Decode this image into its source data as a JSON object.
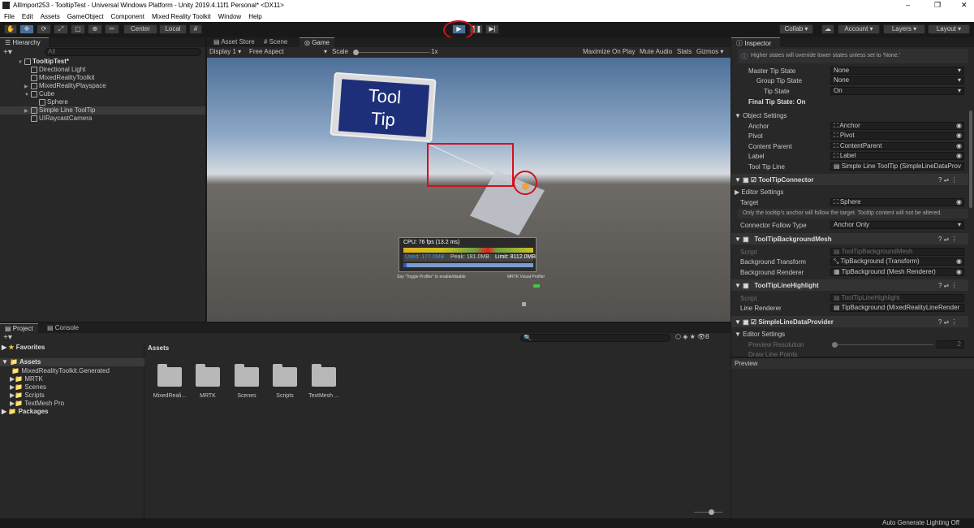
{
  "window": {
    "title": "AllImport253 - TooltipTest - Universal Windows Platform - Unity 2019.4.11f1 Personal* <DX11>",
    "minimize": "–",
    "maximize": "❐",
    "close": "✕"
  },
  "menu": [
    "File",
    "Edit",
    "Assets",
    "GameObject",
    "Component",
    "Mixed Reality Toolkit",
    "Window",
    "Help"
  ],
  "toolbar": {
    "center": "Center",
    "local": "Local",
    "collab": "Collab ▾",
    "account": "Account",
    "layers": "Layers",
    "layout": "Layout"
  },
  "hierarchy": {
    "tab": "Hierarchy",
    "search": "All",
    "scene": "TooltipTest*",
    "items": [
      "Directional Light",
      "MixedRealityToolkit",
      "MixedRealityPlayspace",
      "Cube",
      "Sphere",
      "Simple Line ToolTip",
      "UIRaycastCamera"
    ]
  },
  "center_tabs": [
    "Asset Store",
    "Scene",
    "Game"
  ],
  "game_bar": {
    "display": "Display 1",
    "aspect": "Free Aspect",
    "scale": "Scale",
    "scale_val": "1x",
    "maximize": "Maximize On Play",
    "mute": "Mute Audio",
    "stats": "Stats",
    "gizmos": "Gizmos"
  },
  "scene_view": {
    "tooltip_line1": "Tool",
    "tooltip_line2": "Tip",
    "cpu": "CPU: 76 fps (13.2 ms)",
    "used": "Used: 177.0MB",
    "peak": "Peak: 181.0MB",
    "limit": "Limit: 8112.0MB",
    "say": "Say \"Toggle Profiler\" to enable/disable",
    "mrtk": "MRTK Visual Profiler"
  },
  "inspector": {
    "tab": "Inspector",
    "note": "Higher states will override lower states unless set to 'None.'",
    "master_tip_state": {
      "label": "Master Tip State",
      "value": "None"
    },
    "group_tip_state": {
      "label": "Group Tip State",
      "value": "None"
    },
    "tip_state": {
      "label": "Tip State",
      "value": "On"
    },
    "final_tip_state": "Final Tip State: On",
    "object_settings": "Object Settings",
    "anchor": {
      "label": "Anchor",
      "value": "Anchor"
    },
    "pivot": {
      "label": "Pivot",
      "value": "Pivot"
    },
    "content_parent": {
      "label": "Content Parent",
      "value": "ContentParent"
    },
    "label": {
      "label": "Label",
      "value": "Label"
    },
    "tool_tip_line": {
      "label": "Tool Tip Line",
      "value": "Simple Line ToolTip (SimpleLineDataProv"
    },
    "connector": {
      "title": "ToolTipConnector",
      "editor_settings": "Editor Settings",
      "target_label": "Target",
      "target_value": "Sphere",
      "note": "Only the tooltip's anchor will follow the target. Tooltip content will not be altered.",
      "follow_label": "Connector Follow Type",
      "follow_value": "Anchor Only"
    },
    "bg_mesh": {
      "title": "ToolTipBackgroundMesh",
      "script_label": "Script",
      "script_value": "ToolTipBackgroundMesh",
      "transform_label": "Background Transform",
      "transform_value": "TipBackground (Transform)",
      "renderer_label": "Background Renderer",
      "renderer_value": "TipBackground (Mesh Renderer)"
    },
    "line_highlight": {
      "title": "ToolTipLineHighlight",
      "script_label": "Script",
      "script_value": "ToolTipLineHighlight",
      "renderer_label": "Line Renderer",
      "renderer_value": "TipBackground (MixedRealityLineRender"
    },
    "line_provider": {
      "title": "SimpleLineDataProvider",
      "editor_settings": "Editor Settings",
      "preview_label": "Preview Resolution",
      "preview_value": "2",
      "draw_label": "Draw Line Points"
    },
    "preview": "Preview"
  },
  "project": {
    "tabs": [
      "Project",
      "Console"
    ],
    "favorites": "Favorites",
    "assets_root": "Assets",
    "tree": [
      "MixedRealityToolkit.Generated",
      "MRTK",
      "Scenes",
      "Scripts",
      "TextMesh Pro"
    ],
    "packages": "Packages",
    "assets_header": "Assets",
    "folders": [
      "MixedReali...",
      "MRTK",
      "Scenes",
      "Scripts",
      "TextMesh ..."
    ],
    "badge": "8"
  },
  "status": "Auto Generate Lighting Off"
}
